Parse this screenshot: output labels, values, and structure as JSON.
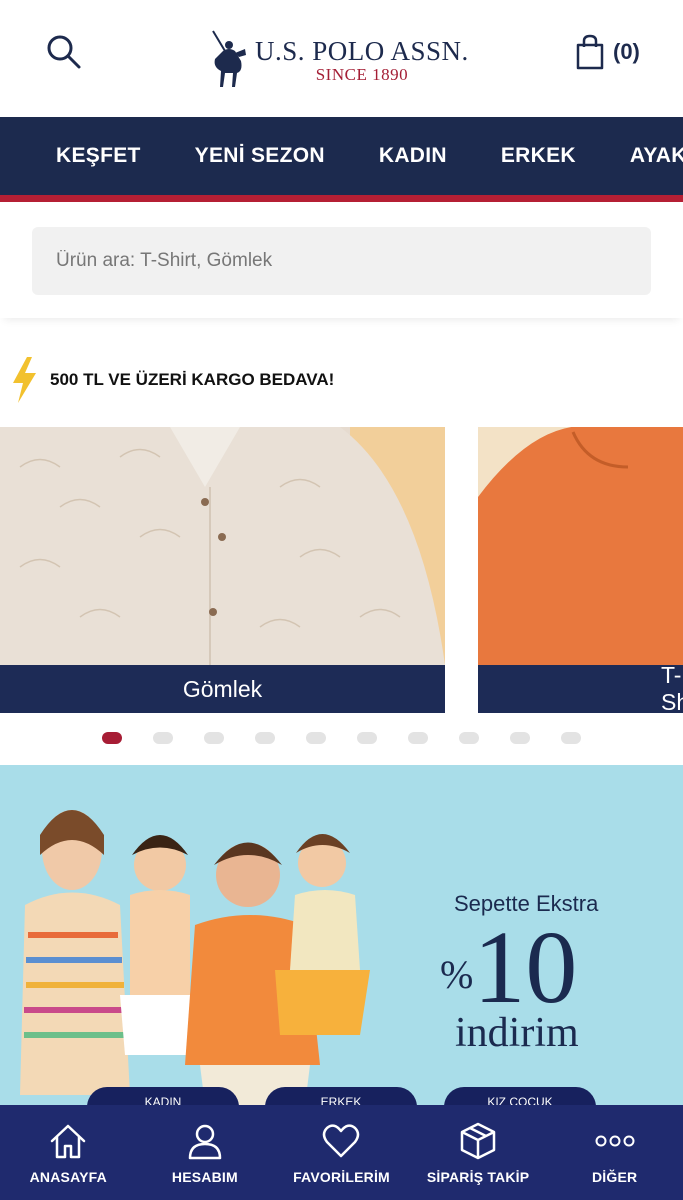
{
  "header": {
    "brand_name": "U.S. POLO ASSN.",
    "brand_since": "SINCE 1890",
    "cart_count": "(0)"
  },
  "nav": {
    "items": [
      "KEŞFET",
      "YENİ SEZON",
      "KADIN",
      "ERKEK",
      "AYAKKABI"
    ]
  },
  "search": {
    "placeholder": "Ürün ara: T-Shirt, Gömlek"
  },
  "promo": {
    "text": "500 TL VE ÜZERİ KARGO BEDAVA!"
  },
  "carousel": {
    "cards": [
      {
        "label": "Gömlek"
      },
      {
        "label": "T-Shirt"
      }
    ],
    "dot_count": 10,
    "active_dot": 0
  },
  "banner": {
    "line1": "Sepette Ekstra",
    "percent": "%",
    "number": "10",
    "line3": "indirim",
    "pills": [
      "KADIN",
      "ERKEK",
      "KIZ ÇOCUK"
    ]
  },
  "tabbar": {
    "items": [
      {
        "label": "ANASAYFA",
        "icon": "home-icon"
      },
      {
        "label": "HESABIM",
        "icon": "user-icon"
      },
      {
        "label": "FAVORİLERİM",
        "icon": "heart-icon"
      },
      {
        "label": "SİPARİŞ TAKİP",
        "icon": "package-icon"
      },
      {
        "label": "DİĞER",
        "icon": "more-icon"
      }
    ]
  },
  "colors": {
    "navy": "#1c2a4e",
    "brand_red": "#b51f34",
    "tabbar_blue": "#1f2a6e",
    "banner_bg": "#a9dde9",
    "promo_bolt": "#f2c12e"
  }
}
